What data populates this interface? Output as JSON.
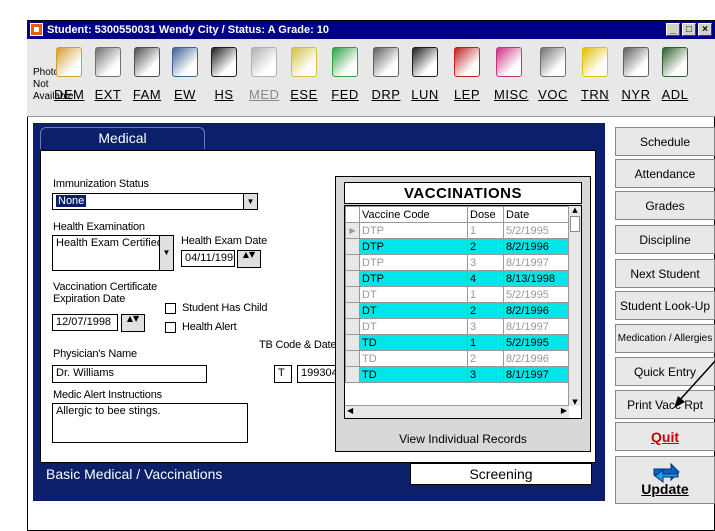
{
  "window": {
    "title": "Student: 5300550031  Wendy City / Status: A  Grade: 10"
  },
  "toolbar": {
    "photo_label": "Photo Not Available",
    "items": [
      {
        "label": "DEM",
        "icon": "id-card-icon",
        "color": "#d0a030"
      },
      {
        "label": "EXT",
        "icon": "building-icon",
        "color": "#707070"
      },
      {
        "label": "FAM",
        "icon": "family-icon",
        "color": "#505050"
      },
      {
        "label": "EW",
        "icon": "cart-icon",
        "color": "#406090"
      },
      {
        "label": "HS",
        "icon": "graduation-cap-icon",
        "color": "#202020"
      },
      {
        "label": "MED",
        "icon": "medical-bag-icon",
        "color": "#b0b0b0",
        "disabled": true
      },
      {
        "label": "ESE",
        "icon": "folder-icon",
        "color": "#d0c040"
      },
      {
        "label": "FED",
        "icon": "money-icon",
        "color": "#30a040"
      },
      {
        "label": "DRP",
        "icon": "cabinet-icon",
        "color": "#606060"
      },
      {
        "label": "LUN",
        "icon": "utensils-icon",
        "color": "#202020"
      },
      {
        "label": "LEP",
        "icon": "book-icon",
        "color": "#c02020"
      },
      {
        "label": "MISC",
        "icon": "symbols-icon",
        "color": "#d03080"
      },
      {
        "label": "VOC",
        "icon": "computer-icon",
        "color": "#707070"
      },
      {
        "label": "TRN",
        "icon": "road-sign-icon",
        "color": "#e0c000"
      },
      {
        "label": "NYR",
        "icon": "calculator-icon",
        "color": "#606060"
      },
      {
        "label": "ADL",
        "icon": "person-icon",
        "color": "#306030"
      }
    ]
  },
  "tabs": {
    "active": "Medical",
    "bottom_left": "Basic Medical / Vaccinations",
    "bottom_right": "Screening"
  },
  "form": {
    "immunization_label": "Immunization Status",
    "immunization_value": "None",
    "health_exam_label": "Health Examination",
    "health_exam_value": "Health Exam Certified",
    "health_exam_date_label": "Health Exam Date",
    "health_exam_date_value": "04/11/1995",
    "vacc_cert_label": "Vaccination Certificate Expiration Date",
    "vacc_cert_label_1": "Vaccination Certificate",
    "vacc_cert_label_2": "Expiration Date",
    "vacc_cert_value": "12/07/1998",
    "student_has_child_label": "Student Has Child",
    "health_alert_label": "Health Alert",
    "tb_label": "TB Code & Date",
    "tb_code": "T",
    "tb_date": "199304",
    "physician_label": "Physician's Name",
    "physician_value": "Dr. Williams",
    "medic_alert_label": "Medic Alert Instructions",
    "medic_alert_value": "Allergic to bee stings."
  },
  "vaccinations": {
    "title": "VACCINATIONS",
    "columns": [
      "Vaccine Code",
      "Dose",
      "Date"
    ],
    "rows": [
      {
        "code": "DTP",
        "dose": "1",
        "date": "5/2/1995",
        "style": "gray",
        "current": true
      },
      {
        "code": "DTP",
        "dose": "2",
        "date": "8/2/1996",
        "style": "hl"
      },
      {
        "code": "DTP",
        "dose": "3",
        "date": "8/1/1997",
        "style": "gray"
      },
      {
        "code": "DTP",
        "dose": "4",
        "date": "8/13/1998",
        "style": "hl"
      },
      {
        "code": "DT",
        "dose": "1",
        "date": "5/2/1995",
        "style": "gray"
      },
      {
        "code": "DT",
        "dose": "2",
        "date": "8/2/1996",
        "style": "hl"
      },
      {
        "code": "DT",
        "dose": "3",
        "date": "8/1/1997",
        "style": "gray"
      },
      {
        "code": "TD",
        "dose": "1",
        "date": "5/2/1995",
        "style": "hl"
      },
      {
        "code": "TD",
        "dose": "2",
        "date": "8/2/1996",
        "style": "gray"
      },
      {
        "code": "TD",
        "dose": "3",
        "date": "8/1/1997",
        "style": "hl"
      }
    ],
    "view_button": "View Individual Records"
  },
  "right_buttons": {
    "schedule": "Schedule",
    "attendance": "Attendance",
    "grades": "Grades",
    "discipline": "Discipline",
    "next_student": "Next Student",
    "student_lookup": "Student Look-Up",
    "medication": "Medication / Allergies",
    "quick_entry": "Quick Entry",
    "print_vacc": "Print Vacc Rpt",
    "quit": "Quit",
    "update": "Update"
  },
  "colors": {
    "highlight_row": "#00e6e6",
    "panel_navy": "#0b1f6b",
    "quit_red": "#cc0000"
  }
}
